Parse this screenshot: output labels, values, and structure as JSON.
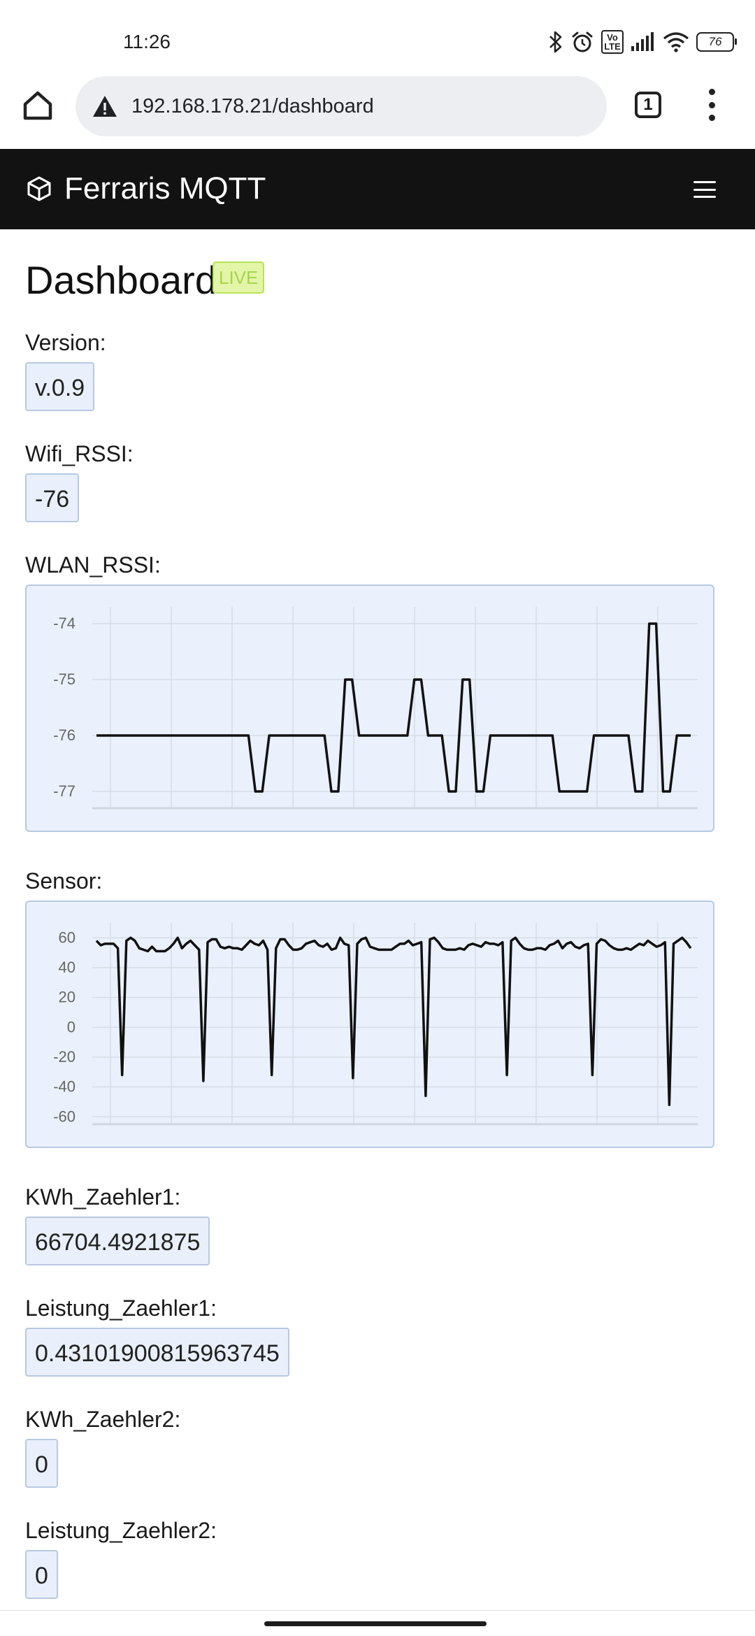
{
  "status_bar": {
    "time": "11:26",
    "icons": [
      "bluetooth-icon",
      "alarm-icon",
      "volte-icon",
      "signal-icon",
      "wifi-icon",
      "battery-icon"
    ],
    "volte_label": "Vo LTE",
    "battery_level": "76"
  },
  "browser": {
    "url": "192.168.178.21/dashboard",
    "tab_count": "1",
    "security": "not-secure-warning-icon"
  },
  "navbar": {
    "brand": "Ferraris MQTT",
    "bg_color": "#121212"
  },
  "page": {
    "title": "Dashboard",
    "badge": "LIVE",
    "badge_color": "#b8e25a"
  },
  "fields": {
    "version": {
      "label": "Version:",
      "value": "v.0.9"
    },
    "wifi_rssi": {
      "label": "Wifi_RSSI:",
      "value": "-76"
    },
    "wlan_rssi": {
      "label": "WLAN_RSSI:"
    },
    "sensor": {
      "label": "Sensor:"
    },
    "kwh_zaehler1": {
      "label": "KWh_Zaehler1:",
      "value": "66704.4921875"
    },
    "leistung_zaehler1": {
      "label": "Leistung_Zaehler1:",
      "value": "0.43101900815963745"
    },
    "kwh_zaehler2": {
      "label": "KWh_Zaehler2:",
      "value": "0"
    },
    "leistung_zaehler2": {
      "label": "Leistung_Zaehler2:",
      "value": "0"
    }
  },
  "chart_data": [
    {
      "type": "line",
      "title": "",
      "xlabel": "",
      "ylabel": "",
      "ylim": [
        -77.3,
        -73.7
      ],
      "yticks": [
        "-74",
        "-75",
        "-76",
        "-77"
      ],
      "grid": true,
      "series": [
        {
          "values": [
            -76,
            -76,
            -76,
            -76,
            -76,
            -76,
            -76,
            -76,
            -76,
            -76,
            -76,
            -76,
            -76,
            -76,
            -76,
            -76,
            -76,
            -76,
            -76,
            -76,
            -76,
            -76,
            -76,
            -77,
            -77,
            -76,
            -76,
            -76,
            -76,
            -76,
            -76,
            -76,
            -76,
            -76,
            -77,
            -77,
            -75,
            -75,
            -76,
            -76,
            -76,
            -76,
            -76,
            -76,
            -76,
            -76,
            -75,
            -75,
            -76,
            -76,
            -76,
            -77,
            -77,
            -75,
            -75,
            -77,
            -77,
            -76,
            -76,
            -76,
            -76,
            -76,
            -76,
            -76,
            -76,
            -76,
            -76,
            -77,
            -77,
            -77,
            -77,
            -77,
            -76,
            -76,
            -76,
            -76,
            -76,
            -76,
            -77,
            -77,
            -74,
            -74,
            -77,
            -77,
            -76,
            -76,
            -76
          ]
        }
      ]
    },
    {
      "type": "line",
      "title": "",
      "xlabel": "",
      "ylabel": "",
      "ylim": [
        -65,
        70
      ],
      "yticks": [
        "60",
        "40",
        "20",
        "0",
        "-20",
        "-40",
        "-60"
      ],
      "grid": true,
      "series": [
        {
          "values": [
            58,
            55,
            56,
            56,
            56,
            53,
            -32,
            58,
            60,
            58,
            53,
            52,
            51,
            54,
            51,
            51,
            51,
            53,
            56,
            60,
            53,
            56,
            58,
            55,
            52,
            -36,
            57,
            59,
            59,
            54,
            53,
            54,
            53,
            53,
            52,
            55,
            58,
            56,
            55,
            58,
            52,
            -32,
            53,
            59,
            59,
            55,
            52,
            52,
            53,
            56,
            57,
            58,
            55,
            54,
            56,
            52,
            53,
            60,
            56,
            55,
            -34,
            56,
            59,
            60,
            54,
            53,
            52,
            52,
            52,
            52,
            54,
            56,
            56,
            58,
            55,
            56,
            57,
            -46,
            59,
            60,
            57,
            53,
            52,
            52,
            52,
            53,
            52,
            55,
            56,
            55,
            54,
            57,
            56,
            56,
            55,
            57,
            -32,
            58,
            60,
            56,
            53,
            52,
            52,
            53,
            53,
            52,
            55,
            56,
            58,
            53,
            56,
            57,
            54,
            53,
            55,
            56,
            -32,
            56,
            59,
            58,
            55,
            53,
            52,
            52,
            53,
            52,
            54,
            56,
            55,
            58,
            56,
            54,
            55,
            57,
            -52,
            56,
            58,
            60,
            57,
            53
          ]
        }
      ]
    }
  ]
}
